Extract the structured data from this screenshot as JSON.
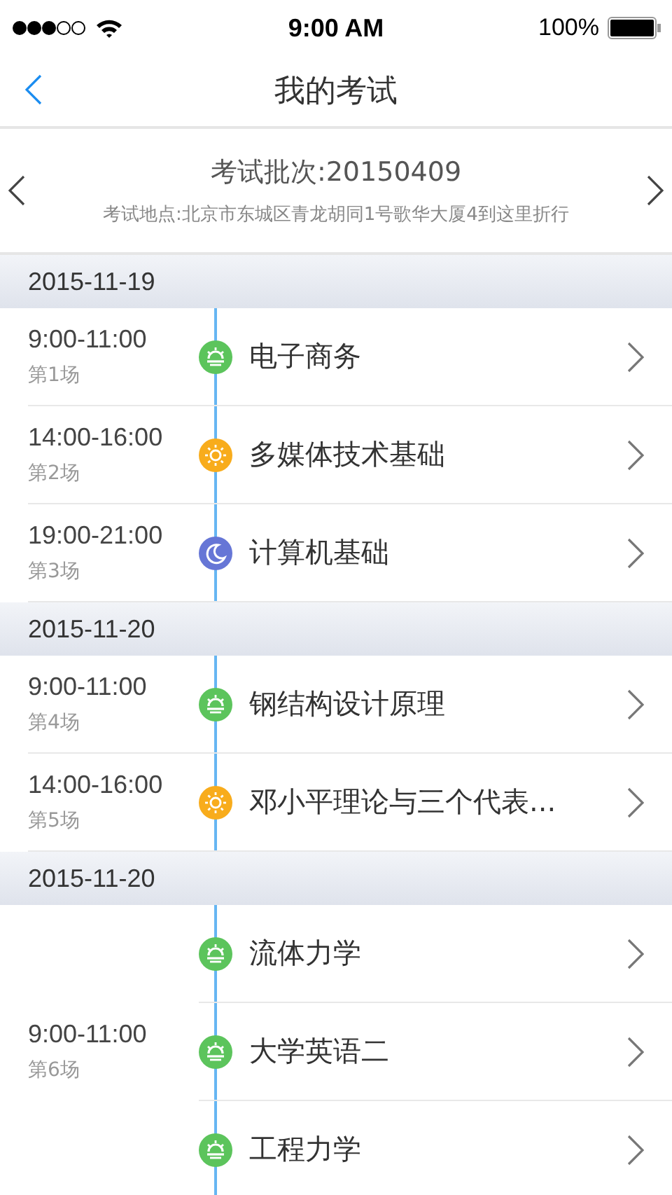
{
  "status_bar": {
    "time": "9:00 AM",
    "battery": "100%"
  },
  "nav": {
    "title": "我的考试"
  },
  "batch": {
    "title": "考试批次:20150409",
    "location": "考试地点:北京市东城区青龙胡同1号歌华大厦4到这里折行"
  },
  "groups": [
    {
      "date": "2015-11-19",
      "sessions": [
        {
          "time": "9:00-11:00",
          "number": "第1场",
          "exams": [
            {
              "name": "电子商务",
              "kind": "morning"
            }
          ]
        },
        {
          "time": "14:00-16:00",
          "number": "第2场",
          "exams": [
            {
              "name": "多媒体技术基础",
              "kind": "afternoon"
            }
          ]
        },
        {
          "time": "19:00-21:00",
          "number": "第3场",
          "exams": [
            {
              "name": "计算机基础",
              "kind": "evening"
            }
          ]
        }
      ]
    },
    {
      "date": "2015-11-20",
      "sessions": [
        {
          "time": "9:00-11:00",
          "number": "第4场",
          "exams": [
            {
              "name": "钢结构设计原理",
              "kind": "morning"
            }
          ]
        },
        {
          "time": "14:00-16:00",
          "number": "第5场",
          "exams": [
            {
              "name": "邓小平理论与三个代表...",
              "kind": "afternoon"
            }
          ]
        }
      ]
    },
    {
      "date": "2015-11-20",
      "sessions": [
        {
          "time": "9:00-11:00",
          "number": "第6场",
          "exams": [
            {
              "name": "流体力学",
              "kind": "morning"
            },
            {
              "name": "大学英语二",
              "kind": "morning"
            },
            {
              "name": "工程力学",
              "kind": "morning"
            }
          ]
        }
      ]
    }
  ]
}
